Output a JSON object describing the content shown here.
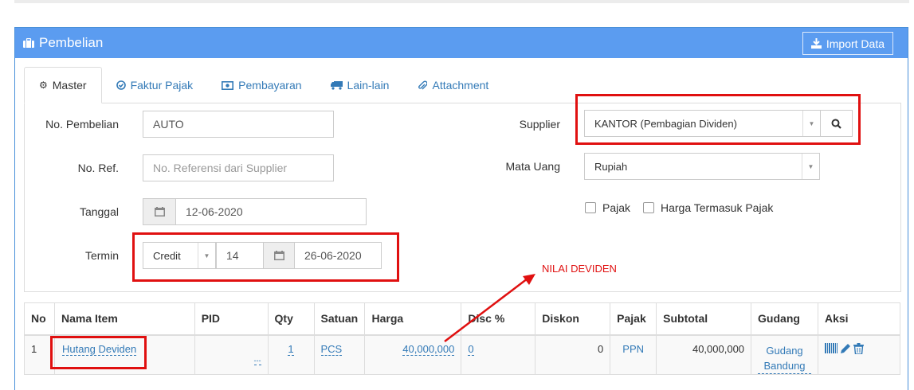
{
  "panel": {
    "title": "Pembelian",
    "import_label": "Import Data"
  },
  "tabs": [
    {
      "label": "Master",
      "icon": "gears-icon",
      "active": true
    },
    {
      "label": "Faktur Pajak",
      "icon": "check-circle-icon"
    },
    {
      "label": "Pembayaran",
      "icon": "money-icon"
    },
    {
      "label": "Lain-lain",
      "icon": "truck-icon"
    },
    {
      "label": "Attachment",
      "icon": "paperclip-icon"
    }
  ],
  "form": {
    "no_pembelian": {
      "label": "No. Pembelian",
      "value": "AUTO"
    },
    "no_ref": {
      "label": "No. Ref.",
      "placeholder": "No. Referensi dari Supplier"
    },
    "tanggal": {
      "label": "Tanggal",
      "value": "12-06-2020"
    },
    "termin": {
      "label": "Termin",
      "type": "Credit",
      "days": "14",
      "date": "26-06-2020"
    },
    "supplier": {
      "label": "Supplier",
      "value": "KANTOR (Pembagian Dividen)"
    },
    "mata_uang": {
      "label": "Mata Uang",
      "value": "Rupiah"
    },
    "pajak_label": "Pajak",
    "harga_termasuk_pajak_label": "Harga Termasuk Pajak"
  },
  "annotation": "NILAI DEVIDEN",
  "table": {
    "headers": [
      "No",
      "Nama Item",
      "PID",
      "Qty",
      "Satuan",
      "Harga",
      "Disc %",
      "Diskon",
      "Pajak",
      "Subtotal",
      "Gudang",
      "Aksi"
    ],
    "rows": [
      {
        "no": "1",
        "nama_item": "Hutang Deviden",
        "pid": "---",
        "qty": "1",
        "satuan": "PCS",
        "harga": "40,000,000",
        "disc": "0",
        "diskon": "0",
        "pajak": "PPN",
        "subtotal": "40,000,000",
        "gudang": "Gudang Bandung"
      }
    ]
  },
  "colors": {
    "header_blue": "#5b9cf0",
    "link_blue": "#337ab7",
    "annotation_red": "#e01010"
  }
}
